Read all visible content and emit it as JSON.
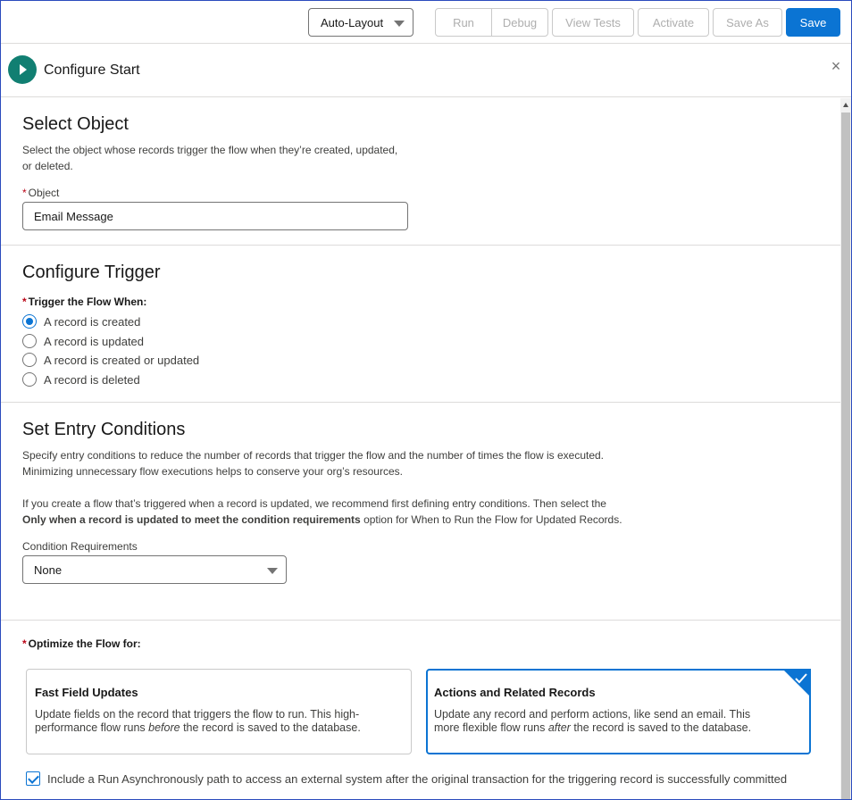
{
  "toolbar": {
    "layout_label": "Auto-Layout",
    "run_label": "Run",
    "debug_label": "Debug",
    "view_tests_label": "View Tests",
    "activate_label": "Activate",
    "save_as_label": "Save As",
    "save_label": "Save"
  },
  "header": {
    "title": "Configure Start",
    "close_icon": "×"
  },
  "select_object": {
    "title": "Select Object",
    "description_line1": "Select the object whose records trigger the flow when they’re created, updated,",
    "description_line2": "or deleted.",
    "required_marker": "*",
    "object_label": "Object",
    "object_value": "Email Message"
  },
  "configure_trigger": {
    "title": "Configure Trigger",
    "required_marker": "*",
    "trigger_label": "Trigger the Flow When:",
    "options": [
      {
        "label": "A record is created",
        "checked": true
      },
      {
        "label": "A record is updated",
        "checked": false
      },
      {
        "label": "A record is created or updated",
        "checked": false
      },
      {
        "label": "A record is deleted",
        "checked": false
      }
    ]
  },
  "entry_conditions": {
    "title": "Set Entry Conditions",
    "description_line1": "Specify entry conditions to reduce the number of records that trigger the flow and the number of times the flow is executed.",
    "description_line2": "Minimizing unnecessary flow executions helps to conserve your org’s resources.",
    "note_line1": "If you create a flow that’s triggered when a record is updated, we recommend first defining entry conditions. Then select the",
    "note_bold": "Only when a record is updated to meet the condition requirements",
    "note_rest": " option for When to Run the Flow for Updated Records.",
    "condition_label": "Condition Requirements",
    "condition_value": "None"
  },
  "optimize": {
    "required_marker": "*",
    "label": "Optimize the Flow for:",
    "cards": [
      {
        "title": "Fast Field Updates",
        "desc_line1": "Update fields on the record that triggers the flow to run. This high-",
        "desc_line2_pre": "performance flow runs ",
        "desc_line2_em": "before",
        "desc_line2_post": " the record is saved to the database.",
        "selected": false
      },
      {
        "title": "Actions and Related Records",
        "desc_line1": "Update any record and perform actions, like send an email. This",
        "desc_line2_pre": "more flexible flow runs ",
        "desc_line2_em": "after",
        "desc_line2_post": " the record is saved to the database.",
        "selected": true
      }
    ],
    "async_label": "Include a Run Asynchronously path to access an external system after the original transaction for the triggering record is successfully committed",
    "async_checked": true
  },
  "colors": {
    "brand": "#0b74d3",
    "start_icon": "#117f72",
    "required": "#ba0517"
  }
}
